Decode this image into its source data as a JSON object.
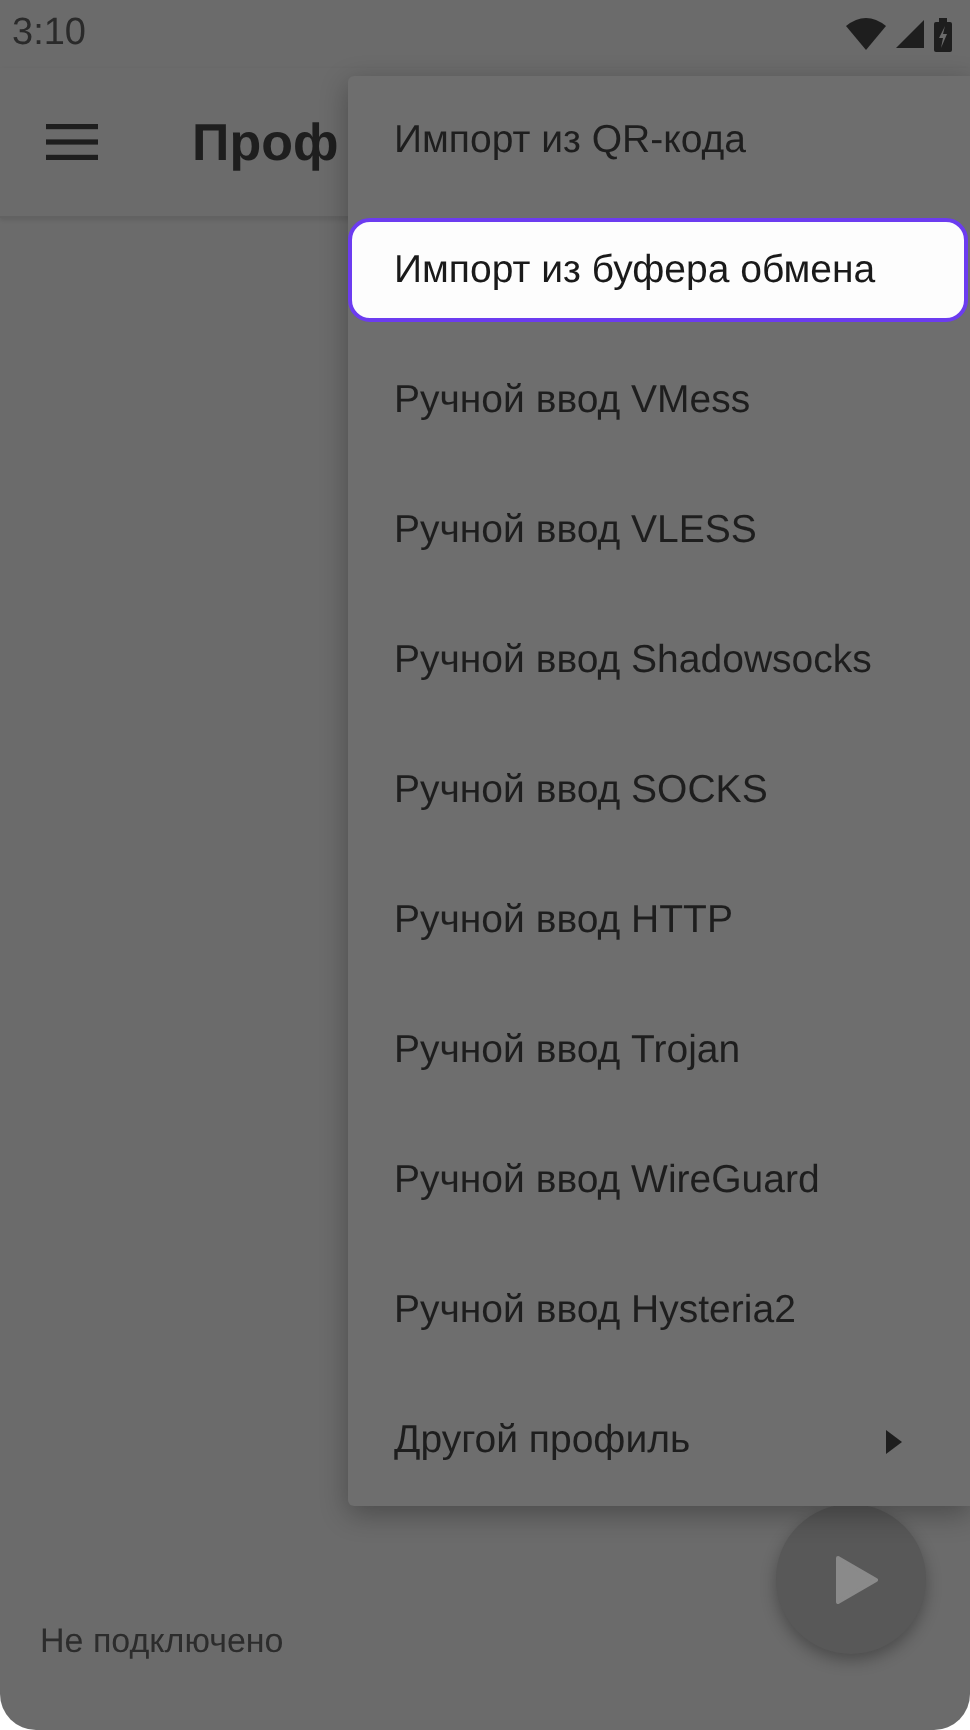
{
  "status_bar": {
    "time": "3:10"
  },
  "app_bar": {
    "title": "Проф"
  },
  "menu": {
    "items": [
      {
        "label": "Импорт из QR-кода",
        "kind": "item",
        "selected": false
      },
      {
        "label": "Импорт из буфера обмена",
        "kind": "item",
        "selected": true
      },
      {
        "label": "Ручной ввод VMess",
        "kind": "item",
        "selected": false
      },
      {
        "label": "Ручной ввод VLESS",
        "kind": "item",
        "selected": false
      },
      {
        "label": "Ручной ввод Shadowsocks",
        "kind": "item",
        "selected": false
      },
      {
        "label": "Ручной ввод SOCKS",
        "kind": "item",
        "selected": false
      },
      {
        "label": "Ручной ввод HTTP",
        "kind": "item",
        "selected": false
      },
      {
        "label": "Ручной ввод Trojan",
        "kind": "item",
        "selected": false
      },
      {
        "label": "Ручной ввод WireGuard",
        "kind": "item",
        "selected": false
      },
      {
        "label": "Ручной ввод Hysteria2",
        "kind": "item",
        "selected": false
      },
      {
        "label": "Другой профиль",
        "kind": "submenu",
        "selected": false
      }
    ]
  },
  "connection_status": "Не подключено"
}
